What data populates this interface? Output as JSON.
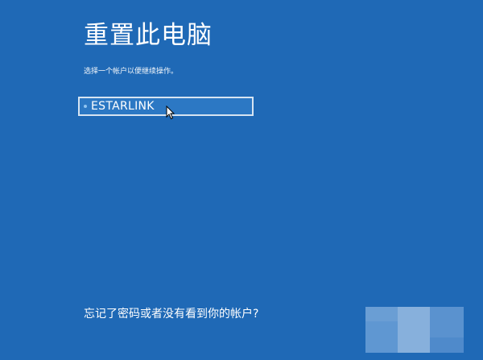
{
  "page": {
    "title": "重置此电脑",
    "instruction": "选择一个帐户以便继续操作。"
  },
  "accounts": [
    {
      "name": "ESTARLINK"
    }
  ],
  "footer": {
    "forgot_link": "忘记了密码或者没有看到你的帐户?"
  },
  "colors": {
    "background": "#1f69b6",
    "account_border": "#d6e4f2",
    "text": "#ffffff"
  }
}
